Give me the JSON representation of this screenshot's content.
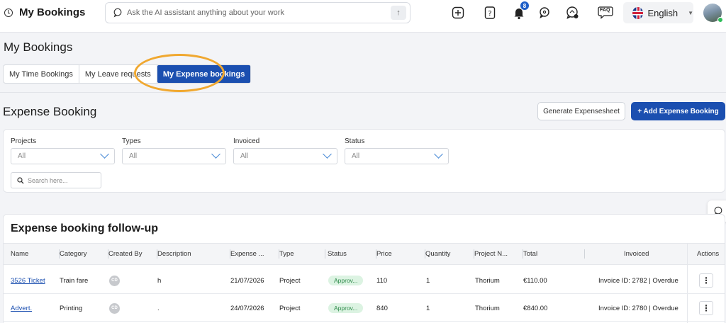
{
  "app": {
    "title": "My Bookings"
  },
  "ai_search": {
    "placeholder": "Ask the AI assistant anything about your work",
    "send_icon": "arrow-up-icon"
  },
  "topbar": {
    "notification_count": "8",
    "faq_label": "FAQ",
    "language": "English"
  },
  "page": {
    "title": "My Bookings"
  },
  "tabs": [
    {
      "label": "My Time Bookings"
    },
    {
      "label": "My Leave requests"
    },
    {
      "label": "My Expense bookings",
      "active": true
    }
  ],
  "expense": {
    "title": "Expense Booking",
    "generate_label": "Generate Expensesheet",
    "add_label": "+ Add Expense Booking"
  },
  "filters": {
    "projects": {
      "label": "Projects",
      "value": "All"
    },
    "types": {
      "label": "Types",
      "value": "All"
    },
    "invoiced": {
      "label": "Invoiced",
      "value": "All"
    },
    "status": {
      "label": "Status",
      "value": "All"
    },
    "search_placeholder": "Search here..."
  },
  "table": {
    "title": "Expense booking follow-up",
    "columns": [
      "Name",
      "Category",
      "Created By",
      "Description",
      "Expense ...",
      "Type",
      "Status",
      "Price",
      "Quantity",
      "Project N...",
      "Total",
      "Invoiced",
      "Actions"
    ],
    "rows": [
      {
        "name": "3526 Ticket",
        "category": "Train fare",
        "created_by": "CD",
        "description": "h",
        "expense_date": "21/07/2026",
        "type": "Project",
        "status": "Approv...",
        "price": "110",
        "quantity": "1",
        "project": "Thorium",
        "total": "€110.00",
        "invoiced": "Invoice ID: 2782 | Overdue",
        "actions": "⋮"
      },
      {
        "name": "Advert.",
        "category": "Printing",
        "created_by": "CD",
        "description": ".",
        "expense_date": "24/07/2026",
        "type": "Project",
        "status": "Approv...",
        "price": "840",
        "quantity": "1",
        "project": "Thorium",
        "total": "€840.00",
        "invoiced": "Invoice ID: 2780 | Overdue",
        "actions": "⋮"
      }
    ]
  },
  "colors": {
    "primary": "#1b4fb0",
    "highlight": "#f0a830",
    "approved_bg": "#dcf3e2",
    "approved_text": "#2d8a4a"
  }
}
